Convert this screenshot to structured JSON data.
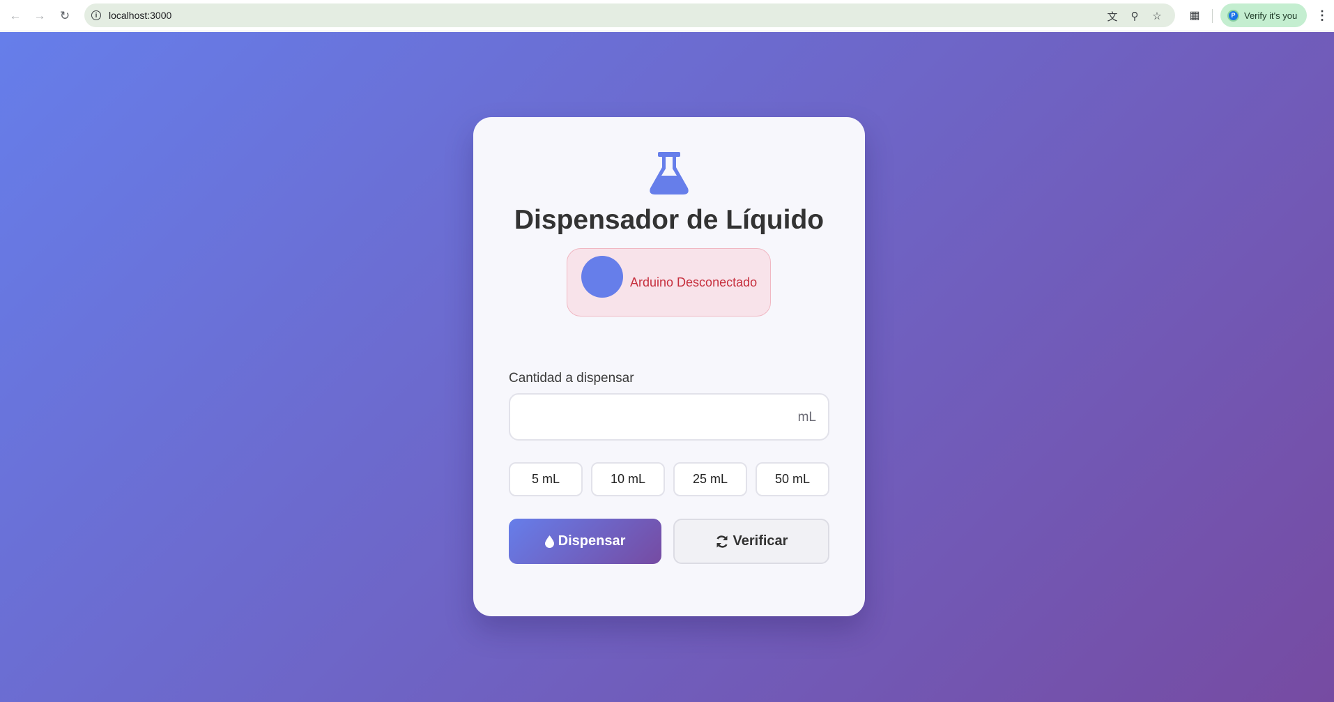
{
  "browser": {
    "url": "localhost:3000",
    "verify_chip_label": "Verify it's you",
    "avatar_initial": "P"
  },
  "app": {
    "title": "Dispensador de Líquido",
    "status_text": "Arduino Desconectado",
    "quantity_label": "Cantidad a dispensar",
    "quantity_value": "",
    "unit": "mL",
    "presets": [
      "5 mL",
      "10 mL",
      "25 mL",
      "50 mL"
    ],
    "dispense_label": "Dispensar",
    "verify_label": "Verificar"
  },
  "colors": {
    "accent_start": "#667eea",
    "accent_end": "#764ba2",
    "status_error": "#c62f3d"
  }
}
